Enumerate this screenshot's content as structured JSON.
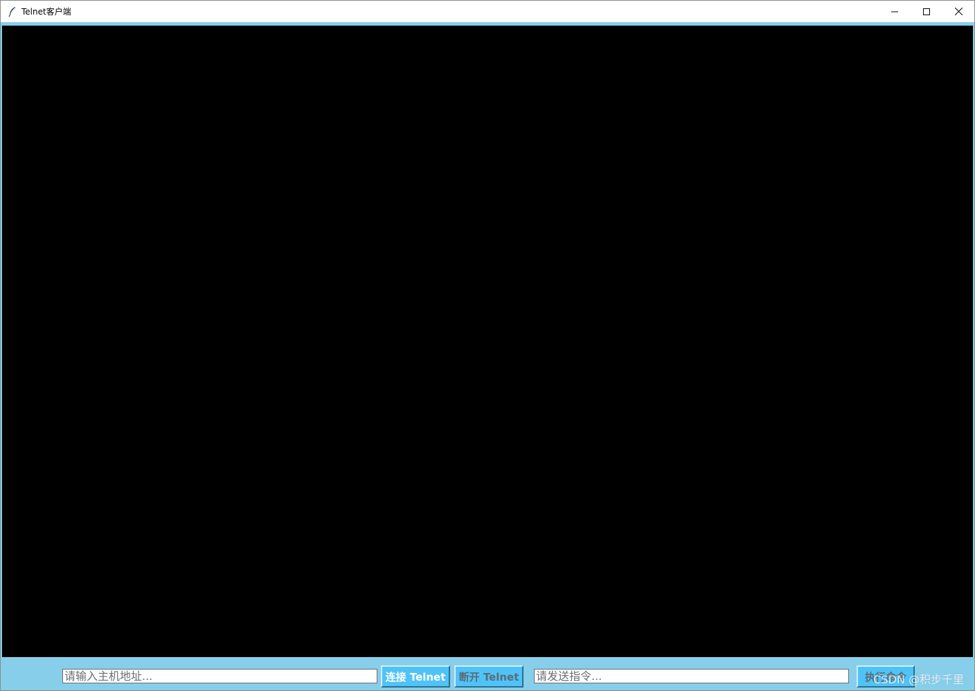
{
  "window": {
    "title": "Telnet客户端",
    "icon": "feather-icon",
    "controls": {
      "minimize_icon": "minimize-icon",
      "maximize_icon": "maximize-icon",
      "close_icon": "close-icon"
    }
  },
  "terminal": {
    "output": "",
    "background": "#000000"
  },
  "toolbar": {
    "host_input": {
      "value": "",
      "placeholder": "请输入主机地址..."
    },
    "connect_button": {
      "label": "连接 Telnet",
      "enabled": true
    },
    "disconnect_button": {
      "label": "断开 Telnet",
      "enabled": false
    },
    "command_input": {
      "value": "",
      "placeholder": "请发送指令..."
    },
    "execute_button": {
      "label": "执行命令",
      "enabled": false
    }
  },
  "watermark": "CSDN @积步千里",
  "colors": {
    "accent": "#87ceeb",
    "button": "#4fc3f7",
    "terminal_bg": "#000000"
  }
}
